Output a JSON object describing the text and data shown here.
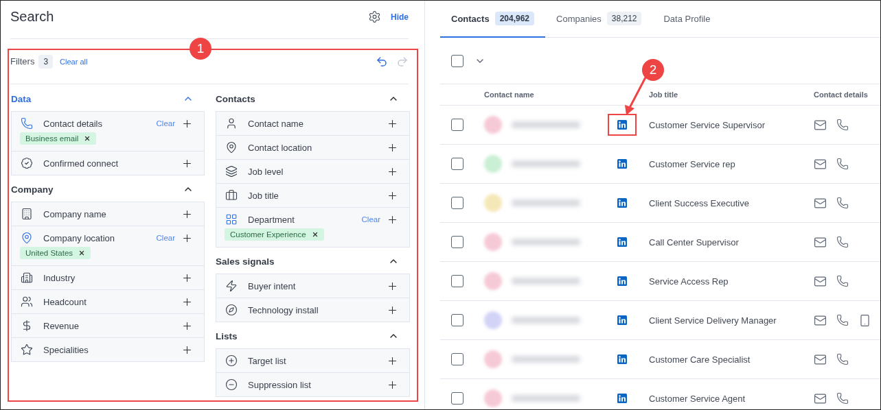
{
  "search_panel": {
    "title": "Search",
    "hide_link": "Hide"
  },
  "filters": {
    "label": "Filters",
    "count": "3",
    "clear_all": "Clear all",
    "undo_enabled": true,
    "redo_enabled": false,
    "columns": [
      [
        {
          "title": "Data",
          "highlighted": true,
          "expanded": true,
          "items": [
            {
              "label": "Contact details",
              "clear": "Clear",
              "chips": [
                "Business email"
              ]
            },
            {
              "label": "Confirmed connect"
            }
          ]
        },
        {
          "title": "Company",
          "highlighted": false,
          "expanded": true,
          "items": [
            {
              "label": "Company name"
            },
            {
              "label": "Company location",
              "clear": "Clear",
              "chips": [
                "United States"
              ]
            },
            {
              "label": "Industry"
            },
            {
              "label": "Headcount"
            },
            {
              "label": "Revenue"
            },
            {
              "label": "Specialities"
            }
          ]
        }
      ],
      [
        {
          "title": "Contacts",
          "highlighted": false,
          "expanded": true,
          "items": [
            {
              "label": "Contact name"
            },
            {
              "label": "Contact location"
            },
            {
              "label": "Job level"
            },
            {
              "label": "Job title"
            },
            {
              "label": "Department",
              "clear": "Clear",
              "chips": [
                "Customer Experience"
              ]
            }
          ]
        },
        {
          "title": "Sales signals",
          "highlighted": false,
          "expanded": true,
          "items": [
            {
              "label": "Buyer intent"
            },
            {
              "label": "Technology install"
            }
          ]
        },
        {
          "title": "Lists",
          "highlighted": false,
          "expanded": true,
          "items": [
            {
              "label": "Target list"
            },
            {
              "label": "Suppression list"
            }
          ]
        }
      ]
    ]
  },
  "tabs": [
    {
      "label": "Contacts",
      "count": "204,962",
      "selected": true
    },
    {
      "label": "Companies",
      "count": "38,212",
      "selected": false
    },
    {
      "label": "Data Profile",
      "selected": false
    }
  ],
  "table": {
    "select_all_checked": false,
    "columns": [
      "Contact name",
      "Job title",
      "Contact details"
    ],
    "rows": [
      {
        "checked": false,
        "color": "#f6c9d6",
        "job_title": "Customer Service Supervisor",
        "has_email": true,
        "has_phone": true,
        "has_mobile": false
      },
      {
        "checked": false,
        "color": "#c9efd4",
        "job_title": "Customer Service rep",
        "has_email": true,
        "has_phone": true,
        "has_mobile": false
      },
      {
        "checked": false,
        "color": "#f5e8b8",
        "job_title": "Client Success Executive",
        "has_email": true,
        "has_phone": true,
        "has_mobile": false
      },
      {
        "checked": false,
        "color": "#f6c9d6",
        "job_title": "Call Center Supervisor",
        "has_email": true,
        "has_phone": true,
        "has_mobile": false
      },
      {
        "checked": false,
        "color": "#f6c9d6",
        "job_title": "Service Access Rep",
        "has_email": true,
        "has_phone": true,
        "has_mobile": false
      },
      {
        "checked": false,
        "color": "#d3d3f7",
        "job_title": "Client Service Delivery Manager",
        "has_email": true,
        "has_phone": true,
        "has_mobile": true
      },
      {
        "checked": false,
        "color": "#f6c9d6",
        "job_title": "Customer Care Specialist",
        "has_email": true,
        "has_phone": true,
        "has_mobile": false
      },
      {
        "checked": false,
        "color": "#f6c9d6",
        "job_title": "Customer Service Agent",
        "has_email": true,
        "has_phone": true,
        "has_mobile": false
      }
    ]
  },
  "annotations": [
    {
      "label": "1"
    },
    {
      "label": "2"
    }
  ]
}
